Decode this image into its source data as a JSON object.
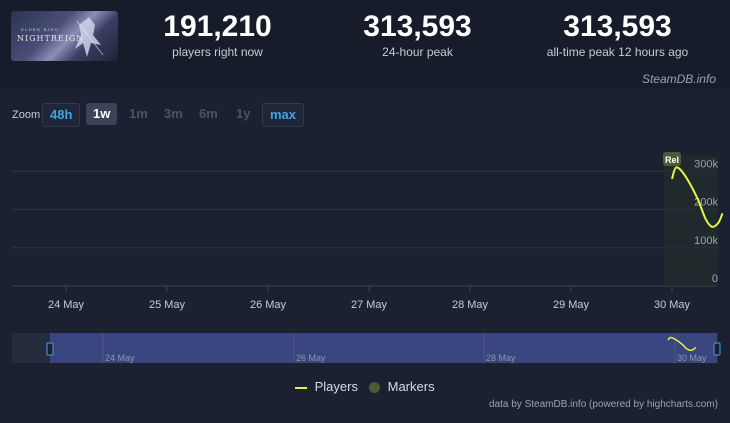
{
  "game": {
    "logo_text": "NIGHTREIGN",
    "logo_subtext": "ELDEN RING"
  },
  "stats": [
    {
      "value": "191,210",
      "label": "players right now"
    },
    {
      "value": "313,593",
      "label": "24-hour peak"
    },
    {
      "value": "313,593",
      "label": "all-time peak 12 hours ago"
    }
  ],
  "source_top": "SteamDB.info",
  "zoom": {
    "label": "Zoom",
    "buttons": [
      "48h",
      "1w",
      "1m",
      "3m",
      "6m",
      "1y",
      "max"
    ],
    "active": "1w",
    "enabled": [
      "48h",
      "1w",
      "max"
    ]
  },
  "chart_data": {
    "type": "line",
    "x_ticks": [
      "24 May",
      "25 May",
      "26 May",
      "27 May",
      "28 May",
      "29 May",
      "30 May"
    ],
    "y_ticks": [
      "0",
      "100k",
      "200k",
      "300k"
    ],
    "ylim": [
      0,
      340000
    ],
    "series": [
      {
        "name": "Players",
        "color": "#e6f545",
        "points": [
          [
            "30 May 00:00",
            280000
          ],
          [
            "30 May 01:00",
            310000
          ],
          [
            "30 May 03:00",
            290000
          ],
          [
            "30 May 06:00",
            230000
          ],
          [
            "30 May 08:00",
            175000
          ],
          [
            "30 May 09:30",
            155000
          ],
          [
            "30 May 11:00",
            165000
          ],
          [
            "30 May 12:00",
            190000
          ]
        ]
      }
    ],
    "markers": [
      {
        "label": "Rel",
        "x": "30 May 00:00"
      }
    ],
    "legend": [
      "Players",
      "Markers"
    ],
    "navigator_ticks": [
      "24 May",
      "26 May",
      "28 May",
      "30 May"
    ]
  },
  "credit_bottom": "data by SteamDB.info (powered by highcharts.com)"
}
